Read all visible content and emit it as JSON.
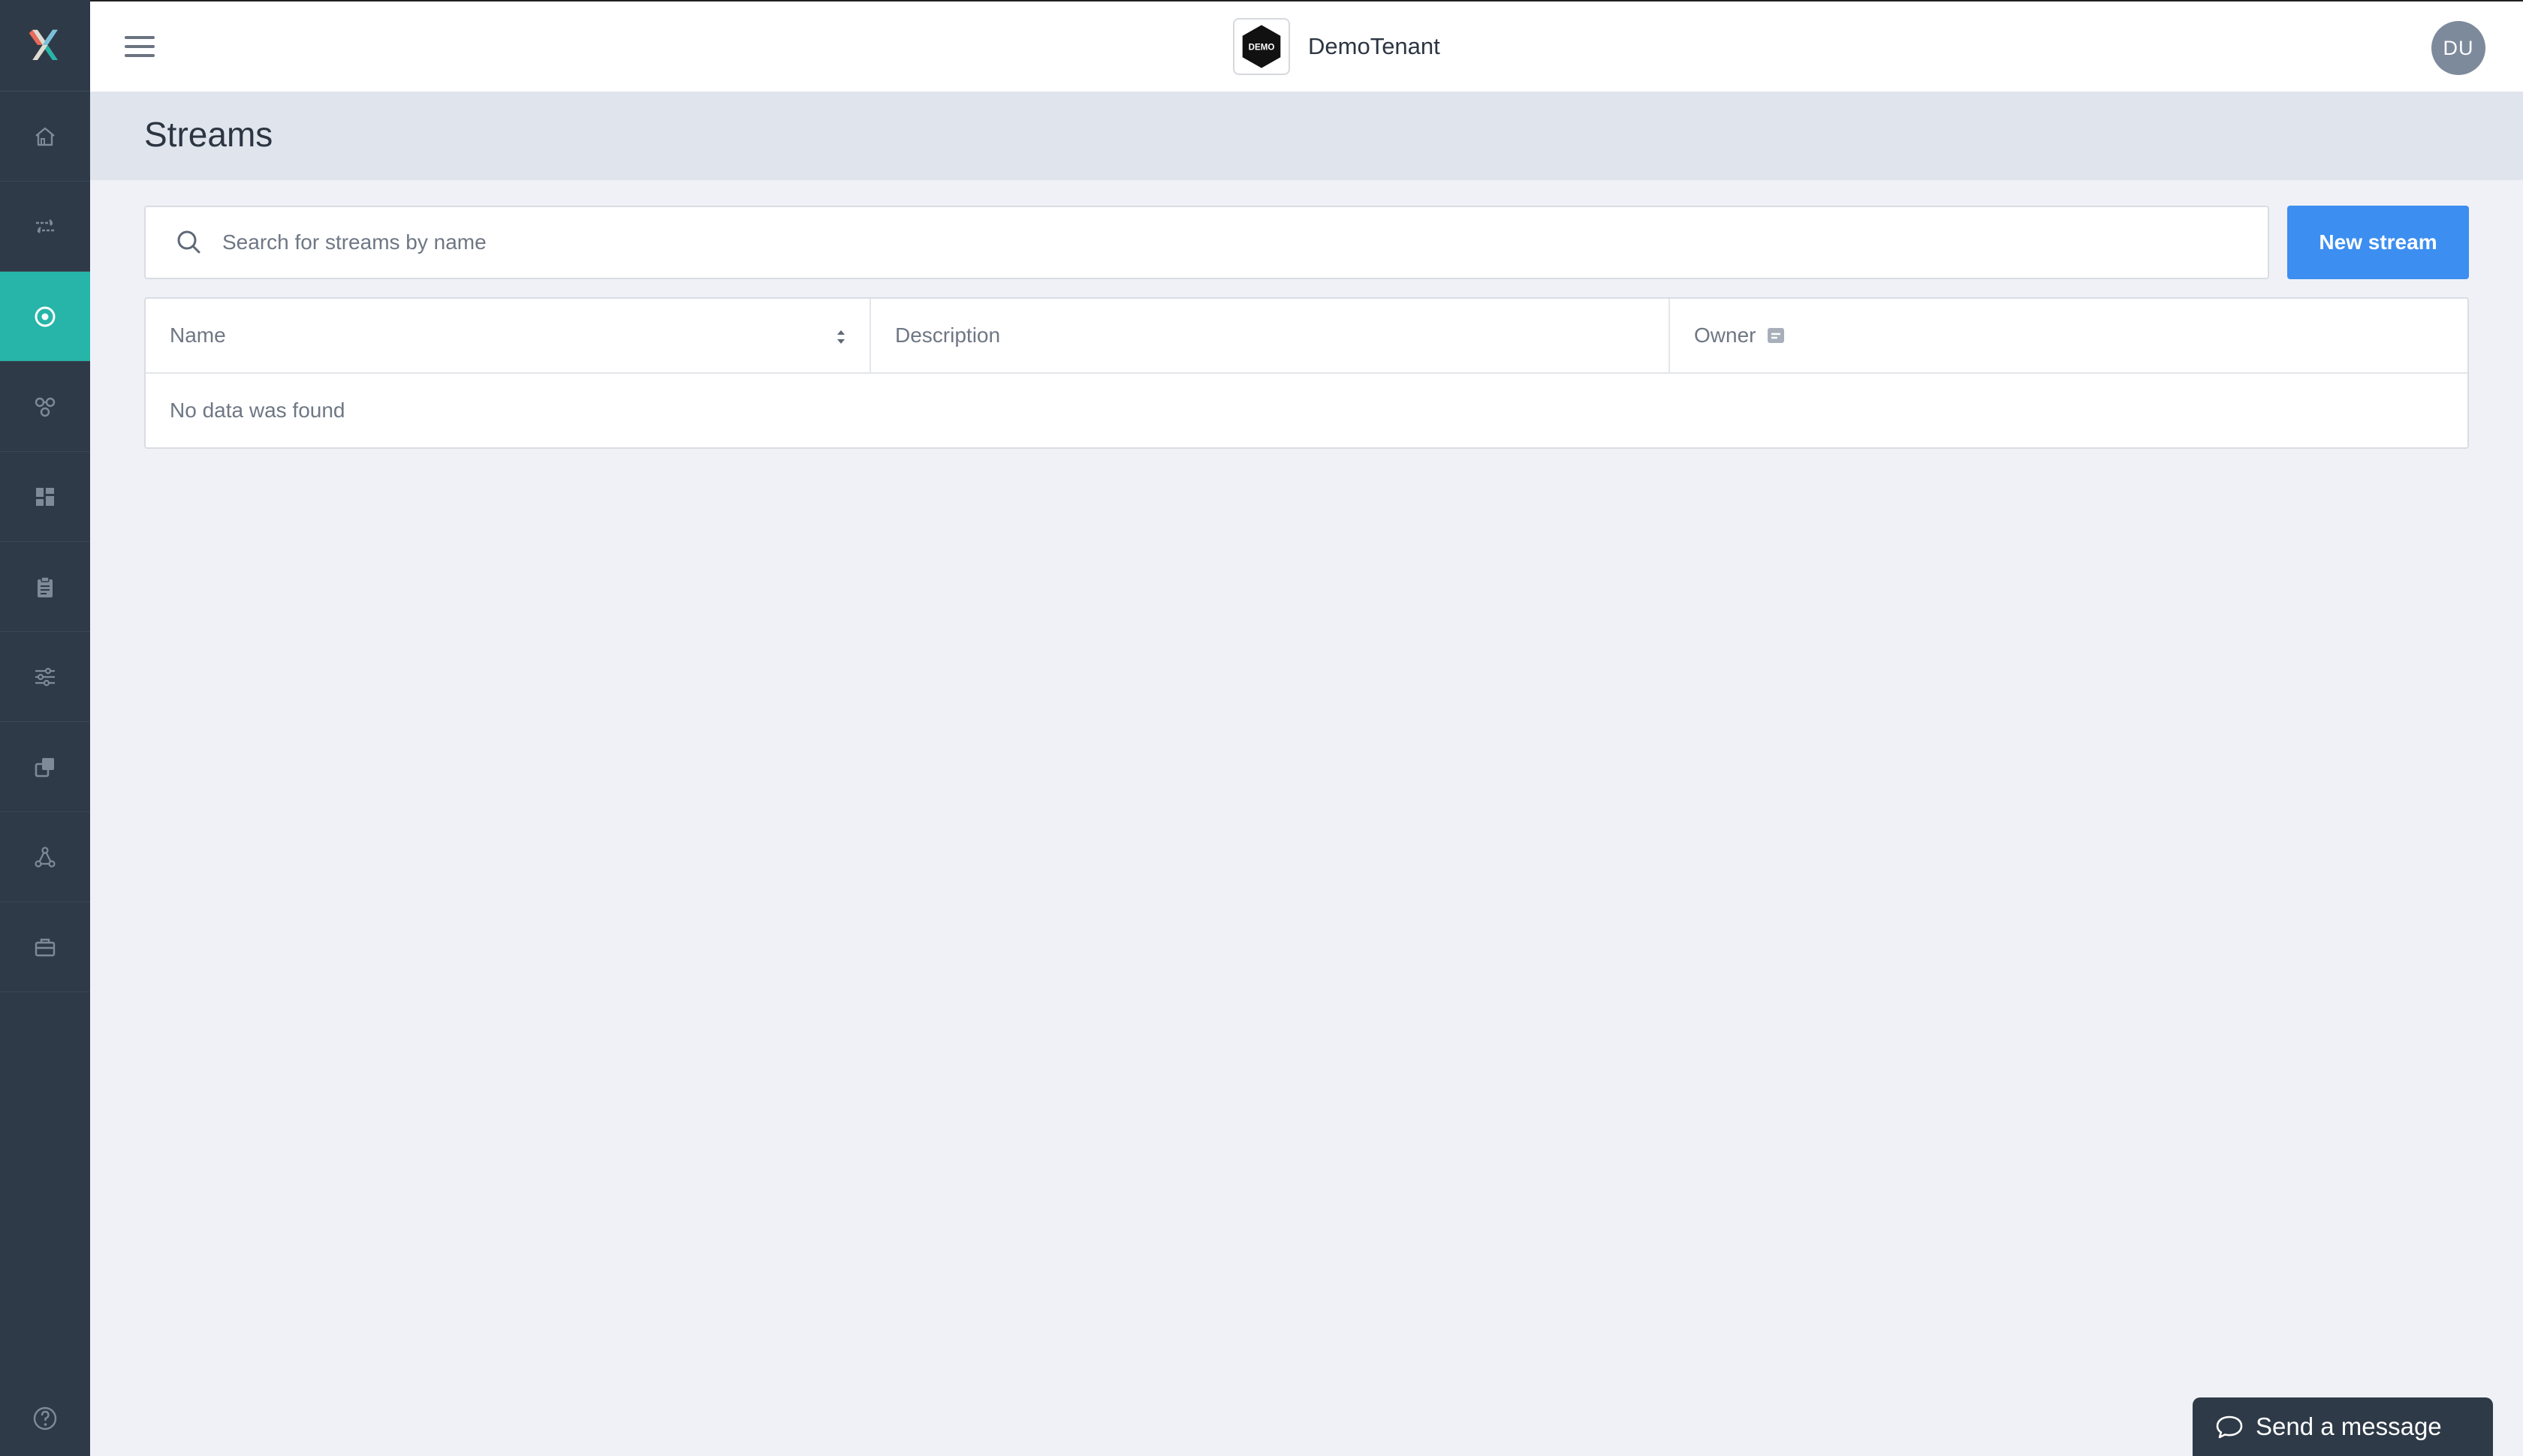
{
  "app": {
    "tenant_logo_text": "DEMO",
    "tenant_name": "DemoTenant",
    "avatar_initials": "DU"
  },
  "sidebar": {
    "items": [
      {
        "icon": "home-icon",
        "active": false
      },
      {
        "icon": "transfer-arrows-icon",
        "active": false
      },
      {
        "icon": "stream-target-icon",
        "active": true
      },
      {
        "icon": "pipelines-icon",
        "active": false
      },
      {
        "icon": "dashboard-grid-icon",
        "active": false
      },
      {
        "icon": "clipboard-icon",
        "active": false
      },
      {
        "icon": "sliders-icon",
        "active": false
      },
      {
        "icon": "copy-icon",
        "active": false
      },
      {
        "icon": "network-icon",
        "active": false
      },
      {
        "icon": "briefcase-icon",
        "active": false
      }
    ],
    "help_icon": "help-icon"
  },
  "page": {
    "title": "Streams"
  },
  "search": {
    "placeholder": "Search for streams by name",
    "value": ""
  },
  "toolbar": {
    "new_label": "New stream"
  },
  "table": {
    "columns": [
      "Name",
      "Description",
      "Owner"
    ],
    "rows": [],
    "empty_text": "No data was found"
  },
  "chat": {
    "label": "Send a message"
  },
  "colors": {
    "sidebar_bg": "#2e3a47",
    "active_teal": "#26b5a8",
    "primary_button": "#3c8ef0",
    "page_bg": "#eff1f6",
    "header_bg": "#e0e4ec"
  }
}
